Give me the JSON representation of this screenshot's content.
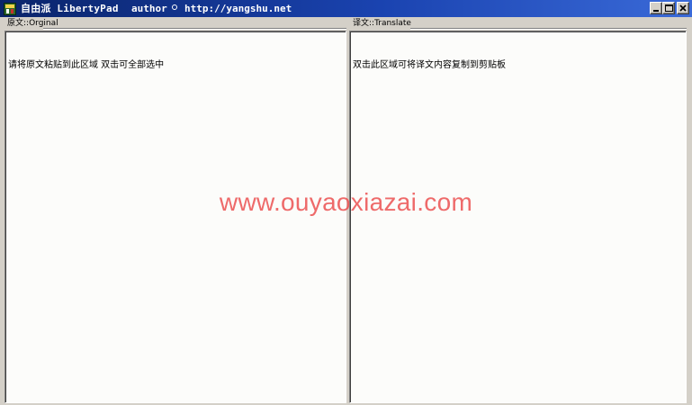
{
  "window": {
    "title": "自由派 LibertyPad",
    "author_label": "author",
    "author_url": "http://yangshu.net",
    "app_icon": "libertypad-app-icon",
    "controls": {
      "minimize_icon": "minimize-icon",
      "maximize_icon": "maximize-icon",
      "close_icon": "close-icon"
    },
    "colors": {
      "titlebar_start": "#0a246a",
      "titlebar_end": "#3a6ad8",
      "chrome": "#d4d0c8",
      "pane_background": "#fcfcfa"
    }
  },
  "original_panel": {
    "header": "原文::Orginal",
    "content": "请将原文粘贴到此区域 双击可全部选中"
  },
  "translate_panel": {
    "header": "译文::Translate",
    "content": "双击此区域可将译文内容复制到剪贴板"
  },
  "watermark": {
    "text": "www.ouyaoxiazai.com",
    "color": "#eb5050"
  }
}
